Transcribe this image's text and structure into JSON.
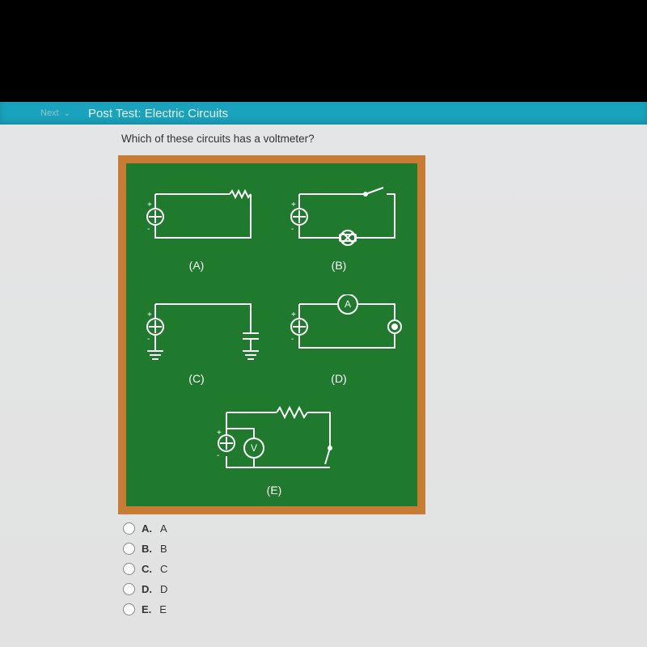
{
  "nav": {
    "next_label": "Next",
    "title": "Post Test: Electric Circuits"
  },
  "question": "Which of these circuits has a voltmeter?",
  "circuit_labels": {
    "a": "(A)",
    "b": "(B)",
    "c": "(C)",
    "d": "(D)",
    "e": "(E)"
  },
  "answers": [
    {
      "letter": "A.",
      "text": "A"
    },
    {
      "letter": "B.",
      "text": "B"
    },
    {
      "letter": "C.",
      "text": "C"
    },
    {
      "letter": "D.",
      "text": "D"
    },
    {
      "letter": "E.",
      "text": "E"
    }
  ],
  "meter": {
    "a_label": "A",
    "v_label": "V"
  }
}
